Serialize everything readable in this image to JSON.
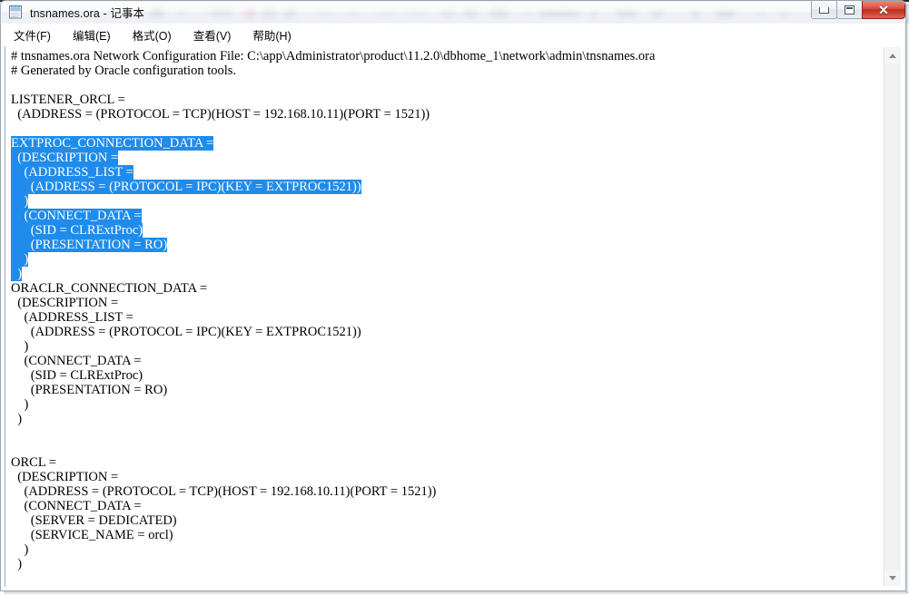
{
  "window": {
    "title": "tnsnames.ora - 记事本",
    "icon": "notepad-icon",
    "controls": {
      "minimize_label": "—",
      "maximize_label": "❐",
      "close_label": "✕"
    }
  },
  "menu": {
    "items": [
      {
        "label": "文件(F)",
        "name": "menu-file"
      },
      {
        "label": "编辑(E)",
        "name": "menu-edit"
      },
      {
        "label": "格式(O)",
        "name": "menu-format"
      },
      {
        "label": "查看(V)",
        "name": "menu-view"
      },
      {
        "label": "帮助(H)",
        "name": "menu-help"
      }
    ]
  },
  "editor": {
    "selection_color": "#1f8cec",
    "selection_text_color": "#ffffff",
    "background_color": "#ffffff",
    "text_color": "#000000",
    "lines": [
      {
        "text": "# tnsnames.ora Network Configuration File: C:\\app\\Administrator\\product\\11.2.0\\dbhome_1\\network\\admin\\tnsnames.ora",
        "selected": false
      },
      {
        "text": "# Generated by Oracle configuration tools.",
        "selected": false
      },
      {
        "text": "",
        "selected": false
      },
      {
        "text": "LISTENER_ORCL =",
        "selected": false
      },
      {
        "text": "  (ADDRESS = (PROTOCOL = TCP)(HOST = 192.168.10.11)(PORT = 1521))",
        "selected": false
      },
      {
        "text": "",
        "selected": false
      },
      {
        "text": "EXTPROC_CONNECTION_DATA =",
        "selected": true
      },
      {
        "text": "  (DESCRIPTION =",
        "selected": true
      },
      {
        "text": "    (ADDRESS_LIST =",
        "selected": true
      },
      {
        "text": "      (ADDRESS = (PROTOCOL = IPC)(KEY = EXTPROC1521))",
        "selected": true
      },
      {
        "text": "    )",
        "selected": true
      },
      {
        "text": "    (CONNECT_DATA =",
        "selected": true
      },
      {
        "text": "      (SID = CLRExtProc)",
        "selected": true
      },
      {
        "text": "      (PRESENTATION = RO)",
        "selected": true
      },
      {
        "text": "    )",
        "selected": true
      },
      {
        "text": "  )",
        "selected": true
      },
      {
        "text": "ORACLR_CONNECTION_DATA =",
        "selected": false
      },
      {
        "text": "  (DESCRIPTION =",
        "selected": false
      },
      {
        "text": "    (ADDRESS_LIST =",
        "selected": false
      },
      {
        "text": "      (ADDRESS = (PROTOCOL = IPC)(KEY = EXTPROC1521))",
        "selected": false
      },
      {
        "text": "    )",
        "selected": false
      },
      {
        "text": "    (CONNECT_DATA =",
        "selected": false
      },
      {
        "text": "      (SID = CLRExtProc)",
        "selected": false
      },
      {
        "text": "      (PRESENTATION = RO)",
        "selected": false
      },
      {
        "text": "    )",
        "selected": false
      },
      {
        "text": "  )",
        "selected": false
      },
      {
        "text": "",
        "selected": false
      },
      {
        "text": "",
        "selected": false
      },
      {
        "text": "ORCL =",
        "selected": false
      },
      {
        "text": "  (DESCRIPTION =",
        "selected": false
      },
      {
        "text": "    (ADDRESS = (PROTOCOL = TCP)(HOST = 192.168.10.11)(PORT = 1521))",
        "selected": false
      },
      {
        "text": "    (CONNECT_DATA =",
        "selected": false
      },
      {
        "text": "      (SERVER = DEDICATED)",
        "selected": false
      },
      {
        "text": "      (SERVICE_NAME = orcl)",
        "selected": false
      },
      {
        "text": "    )",
        "selected": false
      },
      {
        "text": "  )",
        "selected": false
      }
    ]
  },
  "scrollbar": {
    "up_arrow": "scroll-up-arrow-icon",
    "down_arrow": "scroll-down-arrow-icon",
    "thumb_position_percent": 0
  }
}
